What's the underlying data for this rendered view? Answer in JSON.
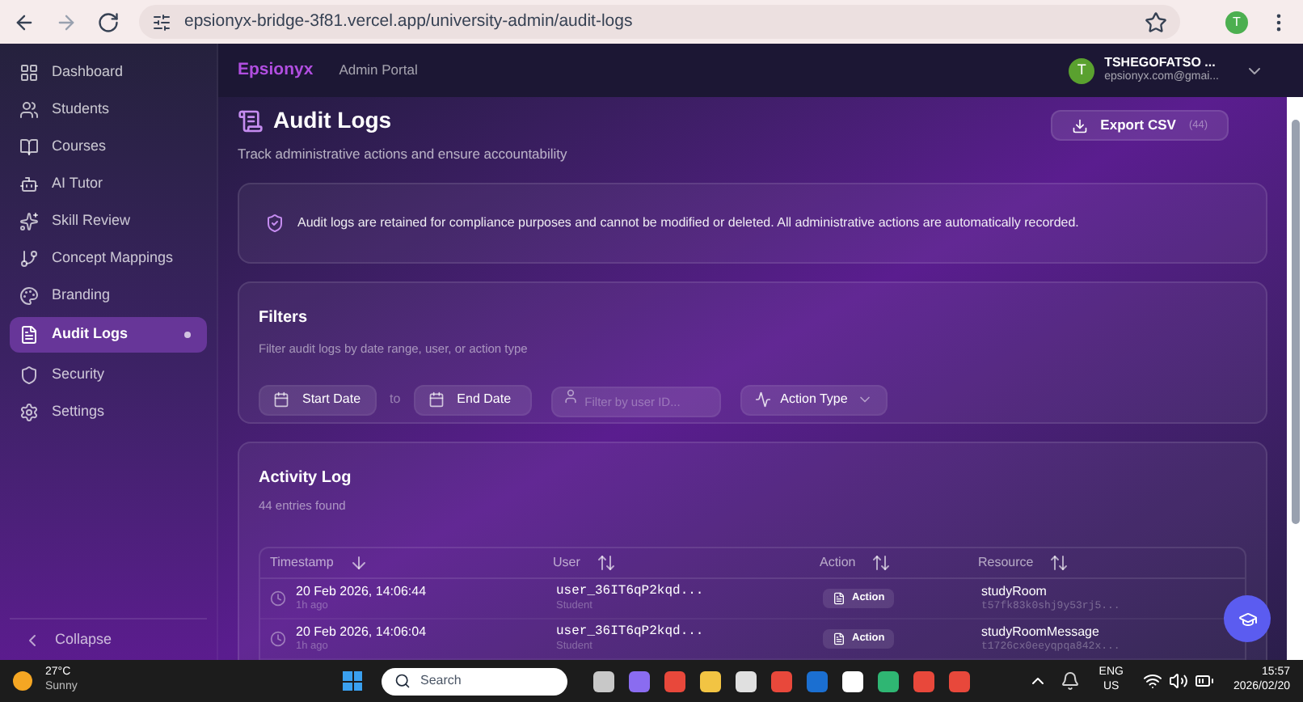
{
  "browser": {
    "url": "epsionyx-bridge-3f81.vercel.app/university-admin/audit-logs",
    "profile": "T"
  },
  "sidebar": {
    "items": [
      {
        "label": "Dashboard",
        "selected": false
      },
      {
        "label": "Students",
        "selected": false
      },
      {
        "label": "Courses",
        "selected": false
      },
      {
        "label": "AI Tutor",
        "selected": false
      },
      {
        "label": "Skill Review",
        "selected": false
      },
      {
        "label": "Concept Mappings",
        "selected": false
      },
      {
        "label": "Branding",
        "selected": false
      },
      {
        "label": "Audit Logs",
        "selected": true
      },
      {
        "label": "Security",
        "selected": false
      },
      {
        "label": "Settings",
        "selected": false
      }
    ],
    "collapse": "Collapse"
  },
  "header": {
    "brand": "Epsionyx",
    "portal": "Admin Portal",
    "avatar": "T",
    "user_name": "TSHEGOFATSO ...",
    "user_email": "epsionyx.com@gmai..."
  },
  "page": {
    "title": "Audit Logs",
    "subtitle": "Track administrative actions and ensure accountability",
    "export_label": "Export CSV",
    "export_count": "(44)"
  },
  "notice": "Audit logs are retained for compliance purposes and cannot be modified or deleted. All administrative actions are automatically recorded.",
  "filters": {
    "title": "Filters",
    "subtitle": "Filter audit logs by date range, user, or action type",
    "start_date": "Start Date",
    "to": "to",
    "end_date": "End Date",
    "user_placeholder": "Filter by user ID...",
    "action_type": "Action Type"
  },
  "activity": {
    "title": "Activity Log",
    "count": "44 entries found",
    "columns": [
      {
        "label": "Timestamp",
        "kind": "sorted"
      },
      {
        "label": "User",
        "kind": "sortable"
      },
      {
        "label": "Action",
        "kind": "sortable"
      },
      {
        "label": "Resource",
        "kind": "sortable"
      }
    ],
    "rows": [
      {
        "timestamp": "20 Feb 2026, 14:06:44",
        "ago": "1h ago",
        "user": "user_36IT6qP2kqd...",
        "role": "Student",
        "action": "Action",
        "resource": "studyRoom",
        "resource_id": "t57fk83k0shj9y53rj5..."
      },
      {
        "timestamp": "20 Feb 2026, 14:06:04",
        "ago": "1h ago",
        "user": "user_36IT6qP2kqd...",
        "role": "Student",
        "action": "Action",
        "resource": "studyRoomMessage",
        "resource_id": "t1726cx0eeyqpqa842x..."
      }
    ]
  },
  "taskbar": {
    "temperature": "27°C",
    "weather": "Sunny",
    "search": "Search",
    "lang": "ENG",
    "region": "US",
    "time": "15:57",
    "date": "2026/02/20"
  }
}
